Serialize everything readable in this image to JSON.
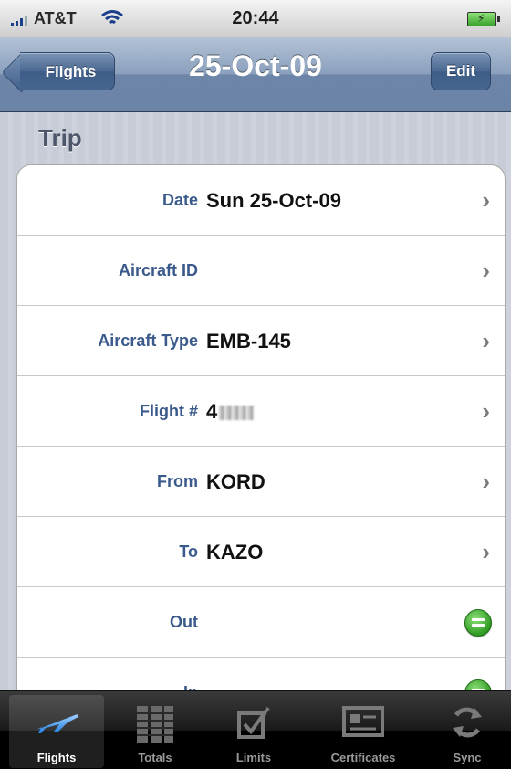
{
  "status_bar": {
    "carrier": "AT&T",
    "time": "20:44"
  },
  "nav": {
    "back_label": "Flights",
    "title": "25-Oct-09",
    "edit_label": "Edit"
  },
  "section": {
    "title": "Trip"
  },
  "rows": [
    {
      "label": "Date",
      "value": "Sun 25-Oct-09",
      "accessory": "chevron"
    },
    {
      "label": "Aircraft ID",
      "value": "",
      "accessory": "chevron"
    },
    {
      "label": "Aircraft Type",
      "value": "EMB-145",
      "accessory": "chevron"
    },
    {
      "label": "Flight #",
      "value": "4",
      "accessory": "chevron",
      "value_obscured": true
    },
    {
      "label": "From",
      "value": "KORD",
      "accessory": "chevron"
    },
    {
      "label": "To",
      "value": "KAZO",
      "accessory": "chevron"
    },
    {
      "label": "Out",
      "value": "",
      "accessory": "green-button"
    },
    {
      "label": "In",
      "value": "",
      "accessory": "green-button"
    }
  ],
  "tabs": [
    {
      "label": "Flights",
      "icon": "airplane-icon",
      "selected": true
    },
    {
      "label": "Totals",
      "icon": "totals-icon",
      "selected": false
    },
    {
      "label": "Limits",
      "icon": "checkbox-icon",
      "selected": false
    },
    {
      "label": "Certificates",
      "icon": "certificate-icon",
      "selected": false
    },
    {
      "label": "Sync",
      "icon": "sync-icon",
      "selected": false
    }
  ],
  "colors": {
    "nav_bar": "#7d94b5",
    "label_text": "#3b5a8c",
    "accessory_green": "#2f9a22"
  }
}
